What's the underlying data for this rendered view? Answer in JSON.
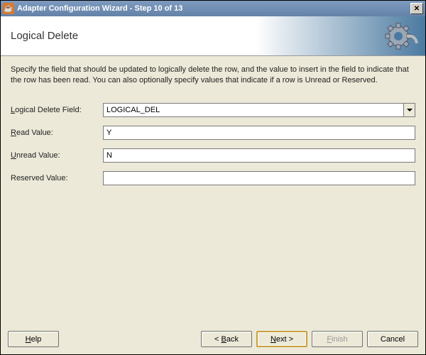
{
  "titlebar": {
    "text": "Adapter Configuration Wizard - Step 10 of 13"
  },
  "header": {
    "page_title": "Logical Delete"
  },
  "instruction": "Specify the field that should be updated to logically delete the row, and the value to insert in the field to indicate that the row has been read.  You can also optionally specify values that indicate if a row is Unread or Reserved.",
  "fields": {
    "logical_delete": {
      "prefix": "L",
      "rest": "ogical Delete Field:",
      "value": "LOGICAL_DEL"
    },
    "read_value": {
      "prefix": "R",
      "rest": "ead Value:",
      "value": "Y"
    },
    "unread_value": {
      "prefix": "U",
      "rest": "nread Value:",
      "value": "N"
    },
    "reserved_value": {
      "label": "Reserved Value:",
      "value": ""
    }
  },
  "buttons": {
    "help": {
      "prefix": "H",
      "rest": "elp"
    },
    "back": {
      "prefix_text": "< ",
      "ul": "B",
      "rest": "ack"
    },
    "next": {
      "ul": "N",
      "rest": "ext >"
    },
    "finish": {
      "prefix_text": "",
      "ul": "F",
      "rest": "inish"
    },
    "cancel": "Cancel"
  }
}
